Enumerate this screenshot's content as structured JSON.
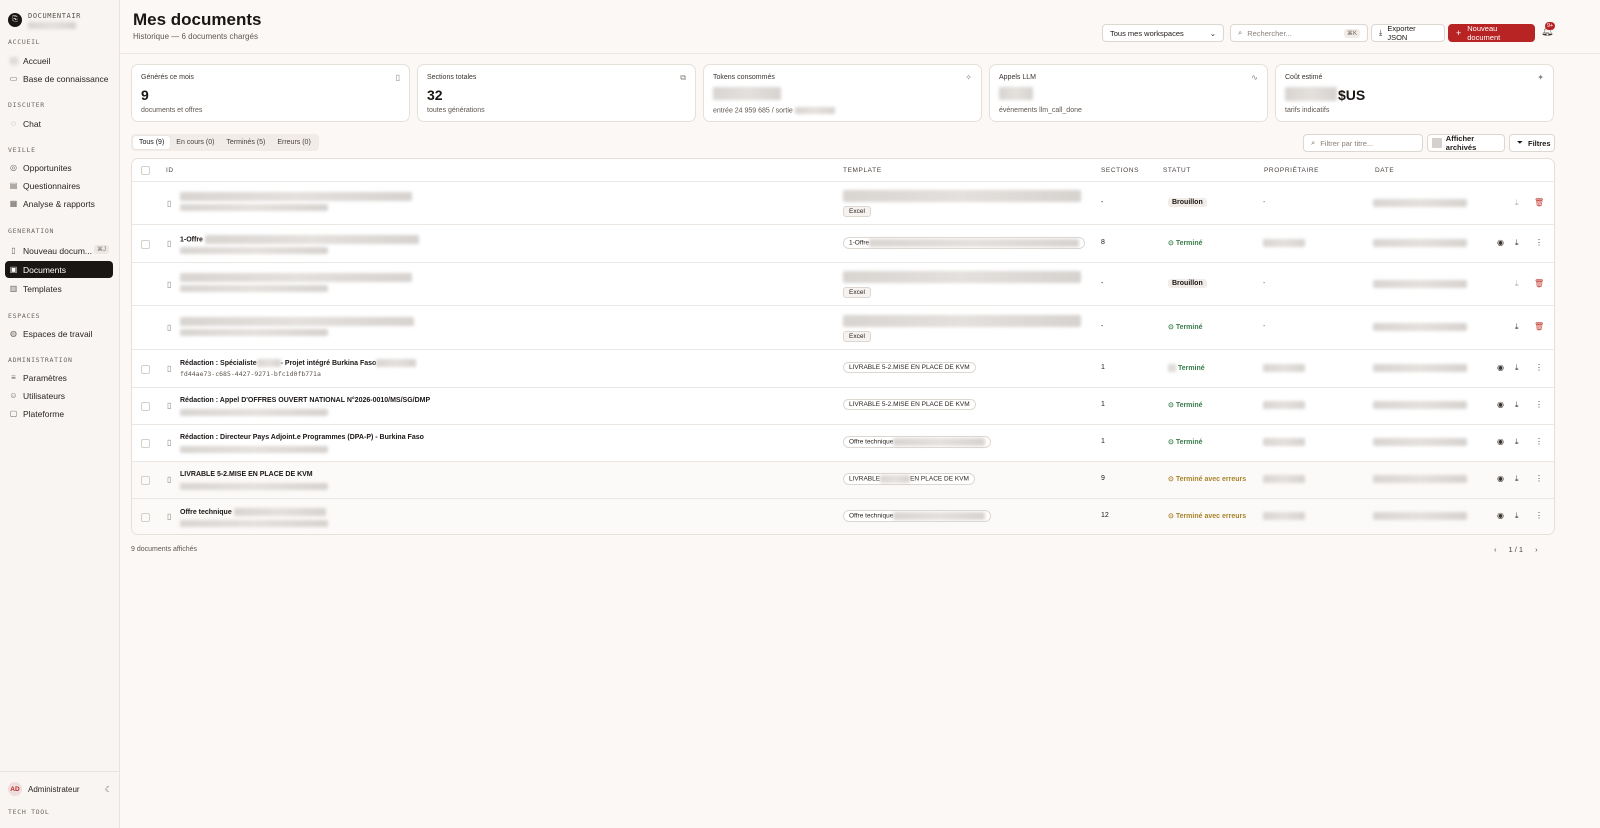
{
  "sidebar": {
    "brand": "DOCUMENTAIR",
    "sections": {
      "accueil": "ACCUEIL",
      "discuter": "DISCUTER",
      "veille": "VEILLE",
      "generation": "GENERATION",
      "espaces": "ESPACES",
      "administration": "ADMINISTRATION"
    },
    "items": {
      "accueil": "Accueil",
      "base": "Base de connaissance",
      "chat": "Chat",
      "opportunites": "Opportunites",
      "questionnaires": "Questionnaires",
      "analyse": "Analyse & rapports",
      "nouveau": "Nouveau docum...",
      "nouveau_badge": "⌘J",
      "documents": "Documents",
      "templates": "Templates",
      "espaces_travail": "Espaces de travail",
      "parametres": "Paramètres",
      "utilisateurs": "Utilisateurs",
      "plateforme": "Plateforme"
    },
    "user": {
      "initials": "AD",
      "name": "Administrateur"
    },
    "footer": "TECH TOOL"
  },
  "header": {
    "title": "Mes documents",
    "subtitle": "Historique — 6 documents chargés",
    "workspace_select": "Tous mes workspaces",
    "search_placeholder": "Rechercher...",
    "search_kbd": "⌘K",
    "export_label": "Exporter JSON",
    "new_doc_label": "Nouveau document",
    "notif_badge": "9+"
  },
  "stats": [
    {
      "label": "Générés ce mois",
      "value": "9",
      "sub": "documents et offres"
    },
    {
      "label": "Sections totales",
      "value": "32",
      "sub": "toutes générations"
    },
    {
      "label": "Tokens consommés",
      "value": "",
      "sub": "entrée 24 959 685 / sortie"
    },
    {
      "label": "Appels LLM",
      "value": "",
      "sub": "événements llm_call_done"
    },
    {
      "label": "Coût estimé",
      "value": "$US",
      "sub": "tarifs indicatifs"
    }
  ],
  "tabs": [
    "Tous (9)",
    "En cours (0)",
    "Terminés (5)",
    "Erreurs (0)"
  ],
  "filters": {
    "title_placeholder": "Filtrer par titre...",
    "archive_label": "Afficher archivés",
    "filters_label": "Filtres"
  },
  "table": {
    "headers": [
      "ID",
      "TEMPLATE",
      "SECTIONS",
      "STATUT",
      "PROPRIÉTAIRE",
      "DATE"
    ],
    "rows": [
      {
        "title": "",
        "template": "",
        "template_tag": "Excel",
        "sections": "-",
        "status": "Brouillon",
        "owner": "-"
      },
      {
        "title": "1-Offre",
        "template": "1-Offre",
        "template_tag": "",
        "sections": "8",
        "status": "Terminé",
        "owner": ""
      },
      {
        "title": "",
        "template": "",
        "template_tag": "Excel",
        "sections": "-",
        "status": "Brouillon",
        "owner": "-"
      },
      {
        "title": "",
        "template": "",
        "template_tag": "Excel",
        "sections": "-",
        "status": "Terminé",
        "owner": "-"
      },
      {
        "title": "Rédaction : Spécialiste",
        "title_b": "- Projet intégré Burkina Faso",
        "mono": "fd44ae73-c685-4427-9271-bfc1d0fb771a",
        "template": "LIVRABLE 5-2.MISE EN PLACE DE KVM",
        "sections": "1",
        "status": "Terminé",
        "owner": ""
      },
      {
        "title": "Rédaction : Appel D'OFFRES OUVERT NATIONAL N°2026-0010/MS/SG/DMP",
        "template": "LIVRABLE 5-2.MISE EN PLACE DE KVM",
        "sections": "1",
        "status": "Terminé",
        "owner": ""
      },
      {
        "title": "Rédaction : Directeur Pays Adjoint.e Programmes (DPA-P) - Burkina Faso",
        "template": "Offre technique",
        "sections": "1",
        "status": "Terminé",
        "owner": ""
      },
      {
        "title": "LIVRABLE 5-2.MISE EN PLACE DE KVM",
        "template": "LIVRABLE",
        "template_b": "EN PLACE DE KVM",
        "sections": "9",
        "status": "Terminé avec erreurs",
        "owner": ""
      },
      {
        "title": "Offre technique",
        "template": "Offre technique",
        "sections": "12",
        "status": "Terminé avec erreurs",
        "owner": ""
      }
    ]
  },
  "footer": {
    "count": "9 documents affichés",
    "page": "1 / 1"
  },
  "colors": {
    "accent": "#b82424",
    "success": "#3a7d4c",
    "warning": "#a8842a",
    "dark": "#1a1614"
  }
}
